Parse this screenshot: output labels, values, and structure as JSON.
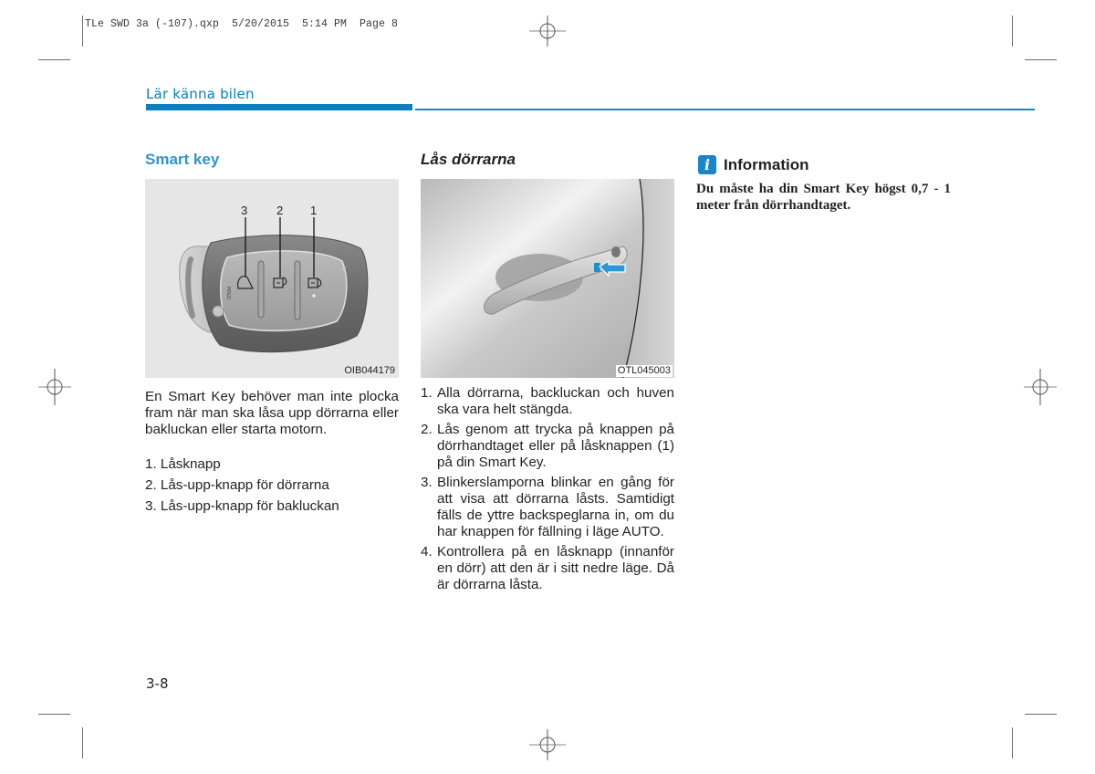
{
  "print_slug": "TLe SWD 3a (-107).qxp  5/20/2015  5:14 PM  Page 8",
  "section_header": "Lär känna bilen",
  "colors": {
    "accent_blue": "#0a7fc1",
    "heading_blue": "#2c95d0",
    "info_icon_blue": "#1a85c8",
    "text": "#231f20"
  },
  "left_column": {
    "heading": "Smart key",
    "figure": {
      "caption": "OIB044179",
      "callouts": [
        "3",
        "2",
        "1"
      ],
      "icons": [
        "trunk-open-icon",
        "unlock-icon",
        "lock-icon"
      ]
    },
    "paragraph": "En Smart Key behöver man inte plocka fram när man ska låsa upp dörrarna eller bakluckan eller starta motorn.",
    "items": [
      "1. Låsknapp",
      "2. Lås-upp-knapp för dörrarna",
      "3. Lås-upp-knapp för bakluckan"
    ]
  },
  "middle_column": {
    "heading": "Lås dörrarna",
    "figure": {
      "caption": "OTL045003"
    },
    "steps": [
      {
        "num": "1.",
        "text": "Alla dörrarna, backluckan och huven ska vara helt stängda."
      },
      {
        "num": "2.",
        "text": "Lås genom att trycka på knappen på dörrhandtaget eller på låsknappen (1) på din Smart Key."
      },
      {
        "num": "3.",
        "text": "Blinkerslamporna blinkar en gång för att visa att dörrarna låsts. Samtidigt fälls de yttre backspeglarna in, om du har knappen för fällning i läge AUTO."
      },
      {
        "num": "4.",
        "text": "Kontrollera på en låsknapp (innanför en dörr) att den är i sitt nedre läge. Då är dörrarna låsta."
      }
    ]
  },
  "right_column": {
    "info": {
      "icon_glyph": "i",
      "title": "Information",
      "text": "Du måste ha din Smart Key högst 0,7 - 1 meter från dörrhandtaget."
    }
  },
  "page_number": "3-8"
}
